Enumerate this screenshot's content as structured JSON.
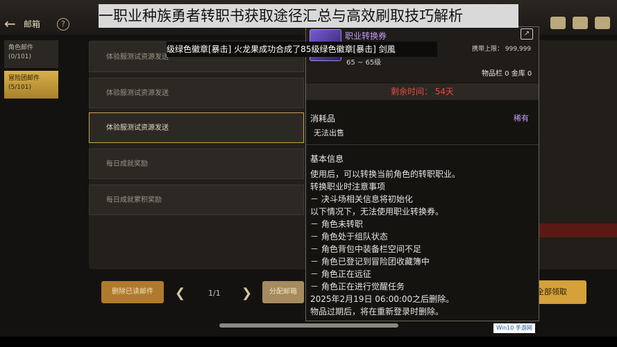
{
  "headline": "一职业种族勇者转职书获取途径汇总与高效刷取技巧解析",
  "topbar": {
    "title": "邮箱",
    "help": "?",
    "back": "←"
  },
  "tabs": [
    {
      "label": "角色邮件",
      "count": "(0/101)"
    },
    {
      "label": "冒险团邮件",
      "count": "(5/101)"
    }
  ],
  "mail_rows": [
    "体验服测试资源发送",
    "体验服测试资源发送",
    "体验服测试资源发送",
    "每日成就奖励",
    "每日成就累积奖励"
  ],
  "notification": {
    "text": "级绿色徽章[暴击]     火龙果成功合成了85级绿色徽章[暴击]     剑風"
  },
  "bottom": {
    "delete_read": "删除已读邮件",
    "page": "1/1",
    "distribute": "分配邮箱",
    "receive_all": "全部领取"
  },
  "tooltip": {
    "item_name": "职业转换券",
    "carry_limit": "携带上限： 999,999",
    "level_range": "65 ~ 65级",
    "inventory": "物品栏 0 金库 0",
    "remaining": "剩余时间： 54天",
    "category": "消耗品",
    "rarity": "稀有",
    "untradeable": "无法出售",
    "basic_info": "基本信息",
    "lines": [
      "使用后，可以转换当前角色的转职职业。",
      "转换职业时注意事项",
      "－ 决斗场相关信息将初始化",
      "以下情况下，无法使用职业转换券。",
      "－ 角色未转职",
      "－ 角色处于组队状态",
      "－ 角色背包中装备栏空间不足",
      "－ 角色已登记到冒险团收藏簿中",
      "－ 角色正在远征",
      "－ 角色正在进行觉醒任务",
      "2025年2月19日 06:00:00之后删除。",
      "物品过期后，将在重新登录时删除。"
    ]
  },
  "watermark": "Win10 手游网",
  "icons": [
    "back-arrow-icon",
    "help-icon",
    "share-icon",
    "prev-page-icon",
    "next-page-icon"
  ]
}
